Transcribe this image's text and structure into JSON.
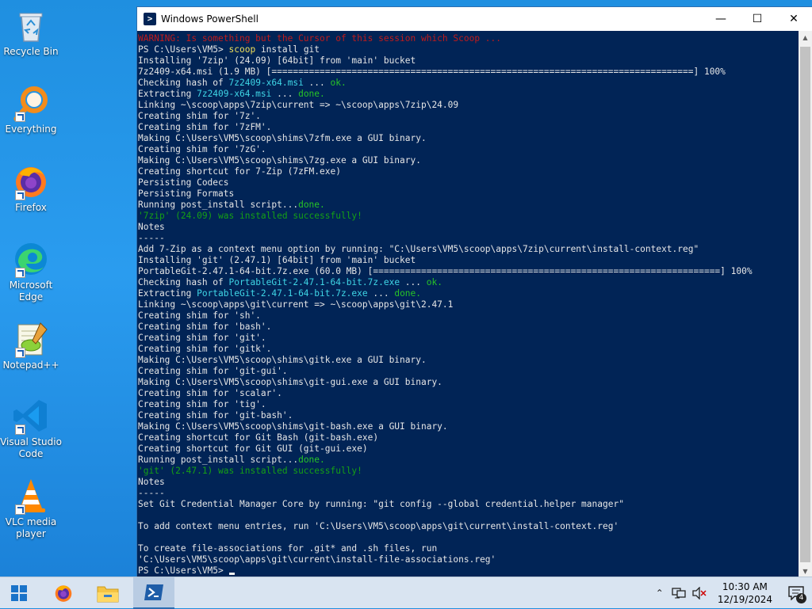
{
  "desktop": {
    "icons": [
      {
        "name": "recycle-bin",
        "label": "Recycle Bin"
      },
      {
        "name": "everything",
        "label": "Everything"
      },
      {
        "name": "firefox",
        "label": "Firefox"
      },
      {
        "name": "microsoft-edge",
        "label": "Microsoft Edge"
      },
      {
        "name": "notepad-plus-plus",
        "label": "Notepad++"
      },
      {
        "name": "visual-studio-code",
        "label": "Visual Studio Code"
      },
      {
        "name": "vlc-media-player",
        "label": "VLC media player"
      }
    ]
  },
  "window": {
    "title": "Windows PowerShell",
    "minimize_glyph": "—",
    "maximize_glyph": "☐",
    "close_glyph": "✕"
  },
  "console": {
    "lines": [
      [
        {
          "t": "WARNING: Is something but the Cursor of this session which Scoop ... ",
          "c": "c-red"
        }
      ],
      [
        {
          "t": "PS C:\\Users\\VM5> ",
          "c": ""
        },
        {
          "t": "scoop",
          "c": "c-yellow"
        },
        {
          "t": " install git",
          "c": ""
        }
      ],
      [
        {
          "t": "Installing '7zip' (24.09) [64bit] from 'main' bucket",
          "c": ""
        }
      ],
      [
        {
          "t": "7z2409-x64.msi (1.9 MB) [===============================================================================] 100%",
          "c": ""
        }
      ],
      [
        {
          "t": "Checking hash of ",
          "c": ""
        },
        {
          "t": "7z2409-x64.msi",
          "c": "c-cyan"
        },
        {
          "t": " ... ",
          "c": ""
        },
        {
          "t": "ok.",
          "c": "c-green"
        }
      ],
      [
        {
          "t": "Extracting ",
          "c": ""
        },
        {
          "t": "7z2409-x64.msi",
          "c": "c-cyan"
        },
        {
          "t": " ... ",
          "c": ""
        },
        {
          "t": "done.",
          "c": "c-green"
        }
      ],
      [
        {
          "t": "Linking ~\\scoop\\apps\\7zip\\current => ~\\scoop\\apps\\7zip\\24.09",
          "c": ""
        }
      ],
      [
        {
          "t": "Creating shim for '7z'.",
          "c": ""
        }
      ],
      [
        {
          "t": "Creating shim for '7zFM'.",
          "c": ""
        }
      ],
      [
        {
          "t": "Making C:\\Users\\VM5\\scoop\\shims\\7zfm.exe a GUI binary.",
          "c": ""
        }
      ],
      [
        {
          "t": "Creating shim for '7zG'.",
          "c": ""
        }
      ],
      [
        {
          "t": "Making C:\\Users\\VM5\\scoop\\shims\\7zg.exe a GUI binary.",
          "c": ""
        }
      ],
      [
        {
          "t": "Creating shortcut for 7-Zip (7zFM.exe)",
          "c": ""
        }
      ],
      [
        {
          "t": "Persisting Codecs",
          "c": ""
        }
      ],
      [
        {
          "t": "Persisting Formats",
          "c": ""
        }
      ],
      [
        {
          "t": "Running post_install script...",
          "c": ""
        },
        {
          "t": "done.",
          "c": "c-green"
        }
      ],
      [
        {
          "t": "'7zip' (24.09) was installed successfully!",
          "c": "c-darkgreen"
        }
      ],
      [
        {
          "t": "Notes",
          "c": ""
        }
      ],
      [
        {
          "t": "-----",
          "c": ""
        }
      ],
      [
        {
          "t": "Add 7-Zip as a context menu option by running: \"C:\\Users\\VM5\\scoop\\apps\\7zip\\current\\install-context.reg\"",
          "c": ""
        }
      ],
      [
        {
          "t": "Installing 'git' (2.47.1) [64bit] from 'main' bucket",
          "c": ""
        }
      ],
      [
        {
          "t": "PortableGit-2.47.1-64-bit.7z.exe (60.0 MB) [=================================================================] 100%",
          "c": ""
        }
      ],
      [
        {
          "t": "Checking hash of ",
          "c": ""
        },
        {
          "t": "PortableGit-2.47.1-64-bit.7z.exe",
          "c": "c-cyan"
        },
        {
          "t": " ... ",
          "c": ""
        },
        {
          "t": "ok.",
          "c": "c-green"
        }
      ],
      [
        {
          "t": "Extracting ",
          "c": ""
        },
        {
          "t": "PortableGit-2.47.1-64-bit.7z.exe",
          "c": "c-cyan"
        },
        {
          "t": " ... ",
          "c": ""
        },
        {
          "t": "done.",
          "c": "c-green"
        }
      ],
      [
        {
          "t": "Linking ~\\scoop\\apps\\git\\current => ~\\scoop\\apps\\git\\2.47.1",
          "c": ""
        }
      ],
      [
        {
          "t": "Creating shim for 'sh'.",
          "c": ""
        }
      ],
      [
        {
          "t": "Creating shim for 'bash'.",
          "c": ""
        }
      ],
      [
        {
          "t": "Creating shim for 'git'.",
          "c": ""
        }
      ],
      [
        {
          "t": "Creating shim for 'gitk'.",
          "c": ""
        }
      ],
      [
        {
          "t": "Making C:\\Users\\VM5\\scoop\\shims\\gitk.exe a GUI binary.",
          "c": ""
        }
      ],
      [
        {
          "t": "Creating shim for 'git-gui'.",
          "c": ""
        }
      ],
      [
        {
          "t": "Making C:\\Users\\VM5\\scoop\\shims\\git-gui.exe a GUI binary.",
          "c": ""
        }
      ],
      [
        {
          "t": "Creating shim for 'scalar'.",
          "c": ""
        }
      ],
      [
        {
          "t": "Creating shim for 'tig'.",
          "c": ""
        }
      ],
      [
        {
          "t": "Creating shim for 'git-bash'.",
          "c": ""
        }
      ],
      [
        {
          "t": "Making C:\\Users\\VM5\\scoop\\shims\\git-bash.exe a GUI binary.",
          "c": ""
        }
      ],
      [
        {
          "t": "Creating shortcut for Git Bash (git-bash.exe)",
          "c": ""
        }
      ],
      [
        {
          "t": "Creating shortcut for Git GUI (git-gui.exe)",
          "c": ""
        }
      ],
      [
        {
          "t": "Running post_install script...",
          "c": ""
        },
        {
          "t": "done.",
          "c": "c-green"
        }
      ],
      [
        {
          "t": "'git' (2.47.1) was installed successfully!",
          "c": "c-darkgreen"
        }
      ],
      [
        {
          "t": "Notes",
          "c": ""
        }
      ],
      [
        {
          "t": "-----",
          "c": ""
        }
      ],
      [
        {
          "t": "Set Git Credential Manager Core by running: \"git config --global credential.helper manager\"",
          "c": ""
        }
      ],
      [
        {
          "t": "",
          "c": ""
        }
      ],
      [
        {
          "t": "To add context menu entries, run 'C:\\Users\\VM5\\scoop\\apps\\git\\current\\install-context.reg'",
          "c": ""
        }
      ],
      [
        {
          "t": "",
          "c": ""
        }
      ],
      [
        {
          "t": "To create file-associations for .git* and .sh files, run",
          "c": ""
        }
      ],
      [
        {
          "t": "'C:\\Users\\VM5\\scoop\\apps\\git\\current\\install-file-associations.reg'",
          "c": ""
        }
      ],
      [
        {
          "t": "PS C:\\Users\\VM5> ",
          "c": ""
        }
      ]
    ]
  },
  "taskbar": {
    "time": "10:30 AM",
    "date": "12/19/2024",
    "notification_count": "4",
    "colors": {
      "background": "#d9e4f1",
      "active": "#b9cce3"
    }
  }
}
